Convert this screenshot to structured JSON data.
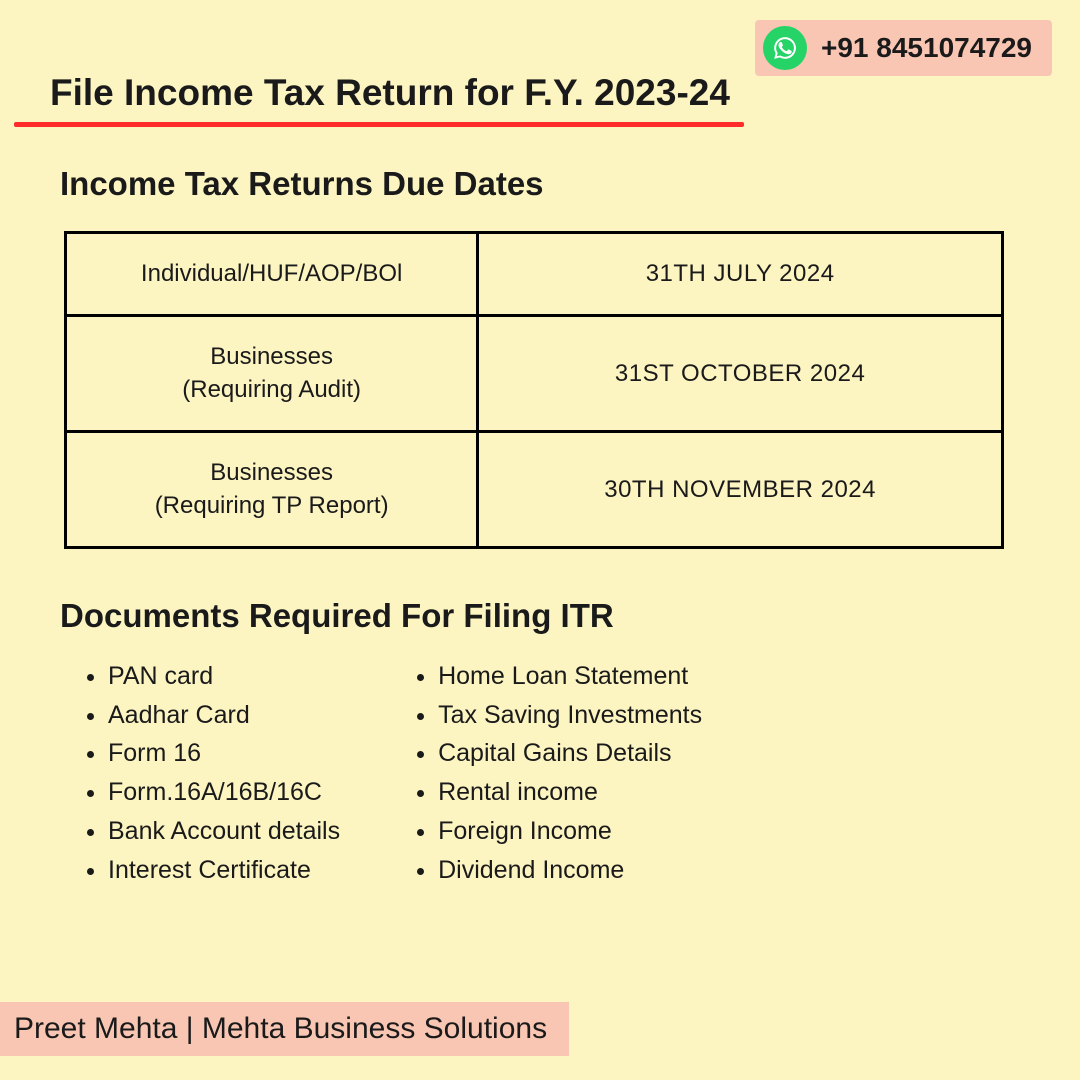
{
  "contact": {
    "phone": "+91 8451074729"
  },
  "title": "File Income Tax Return for F.Y. 2023-24",
  "sections": {
    "due_dates_title": "Income Tax Returns Due Dates",
    "docs_title": "Documents Required For Filing ITR"
  },
  "due_dates": [
    {
      "category": "Individual/HUF/AOP/BOl",
      "date": "31TH JULY 2024"
    },
    {
      "category": "Businesses\n(Requiring Audit)",
      "date": "31ST OCTOBER 2024"
    },
    {
      "category": "Businesses\n(Requiring TP Report)",
      "date": "30TH NOVEMBER 2024"
    }
  ],
  "docs_left": [
    " PAN card",
    "Aadhar Card",
    "Form 16",
    "Form.16A/16B/16C",
    "Bank Account details",
    "Interest Certificate"
  ],
  "docs_right": [
    "Home Loan Statement",
    "Tax Saving Investments",
    "Capital Gains Details",
    "Rental income",
    "Foreign Income",
    "Dividend Income"
  ],
  "footer": "Preet Mehta | Mehta Business Solutions"
}
